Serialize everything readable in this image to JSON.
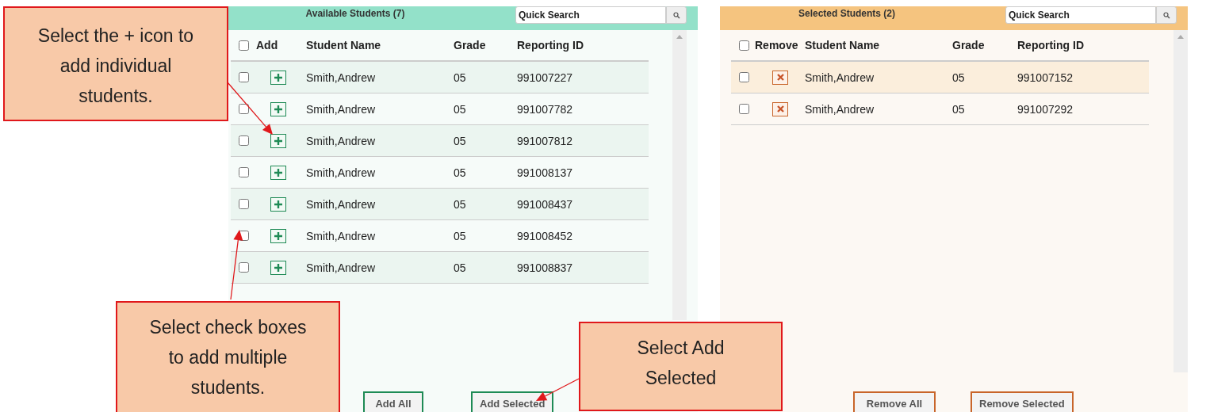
{
  "available": {
    "title": "Available Students (7)",
    "search": {
      "placeholder": "Quick Search"
    },
    "columns": [
      "Add",
      "Student Name",
      "Grade",
      "Reporting ID"
    ],
    "all_checked": false,
    "rows": [
      {
        "checked": false,
        "name": "Smith,Andrew",
        "grade": "05",
        "id": "991007227"
      },
      {
        "checked": false,
        "name": "Smith,Andrew",
        "grade": "05",
        "id": "991007782"
      },
      {
        "checked": false,
        "name": "Smith,Andrew",
        "grade": "05",
        "id": "991007812"
      },
      {
        "checked": false,
        "name": "Smith,Andrew",
        "grade": "05",
        "id": "991008137"
      },
      {
        "checked": false,
        "name": "Smith,Andrew",
        "grade": "05",
        "id": "991008437"
      },
      {
        "checked": false,
        "name": "Smith,Andrew",
        "grade": "05",
        "id": "991008452"
      },
      {
        "checked": false,
        "name": "Smith,Andrew",
        "grade": "05",
        "id": "991008837"
      }
    ],
    "buttons": [
      "Add All",
      "Add Selected"
    ]
  },
  "selected": {
    "title": "Selected Students (2)",
    "search": {
      "placeholder": "Quick Search"
    },
    "columns": [
      "Remove",
      "Student Name",
      "Grade",
      "Reporting ID"
    ],
    "all_checked": false,
    "rows": [
      {
        "checked": false,
        "name": "Smith,Andrew",
        "grade": "05",
        "id": "991007152"
      },
      {
        "checked": false,
        "name": "Smith,Andrew",
        "grade": "05",
        "id": "991007292"
      }
    ],
    "buttons": [
      "Remove All",
      "Remove Selected"
    ]
  },
  "callouts": [
    {
      "text": "Select the + icon to add individual students."
    },
    {
      "text": "Select check boxes to add multiple students."
    },
    {
      "text": "Select Add Selected"
    }
  ]
}
